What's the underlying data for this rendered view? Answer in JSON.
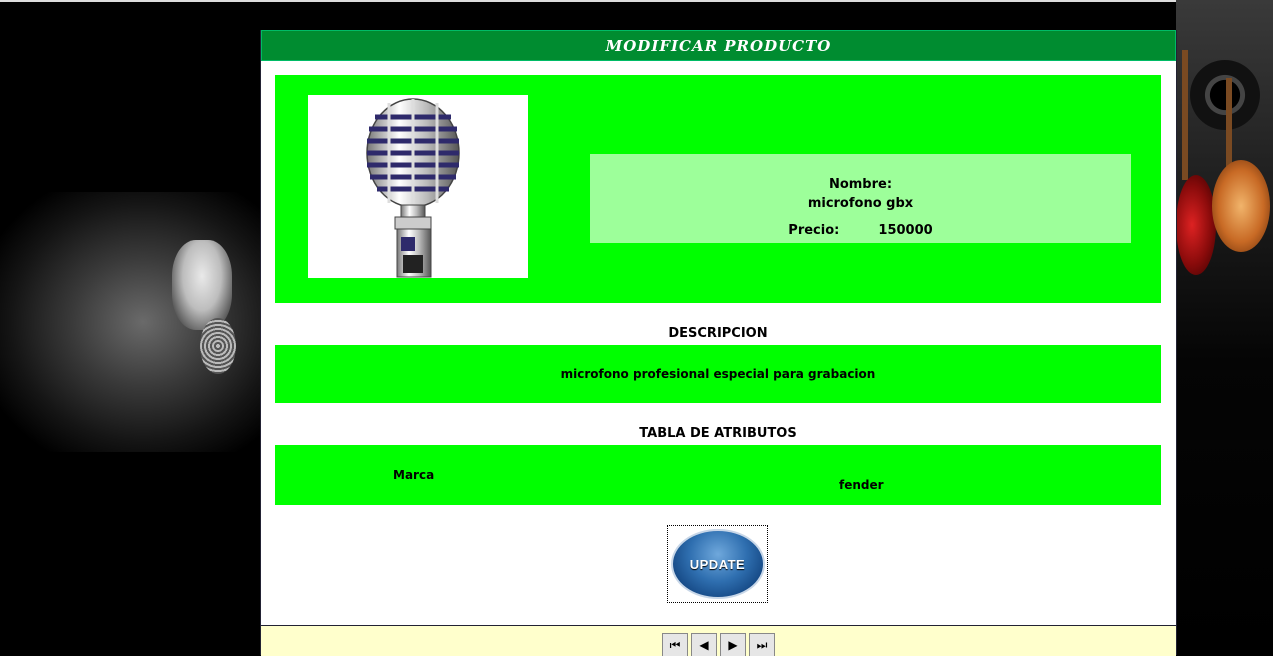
{
  "header": {
    "title": "MODIFICAR PRODUCTO"
  },
  "product": {
    "image_alt": "microphone-image",
    "name_label": "Nombre:",
    "name_value": "microfono gbx",
    "price_label": "Precio:",
    "price_value": "150000"
  },
  "description": {
    "title": "DESCRIPCION",
    "text": "microfono profesional especial para grabacion"
  },
  "attributes": {
    "title": "TABLA DE ATRIBUTOS",
    "rows": [
      {
        "name": "Marca",
        "value": "fender"
      }
    ]
  },
  "actions": {
    "update_label": "UPDATE"
  },
  "pager": {
    "first": "⏮",
    "prev": "◀",
    "next": "▶",
    "last": "⏭"
  },
  "colors": {
    "header_green": "#008c30",
    "box_green": "#00ff00",
    "info_green": "#9dff9a",
    "footer_yellow": "#ffffcc"
  }
}
